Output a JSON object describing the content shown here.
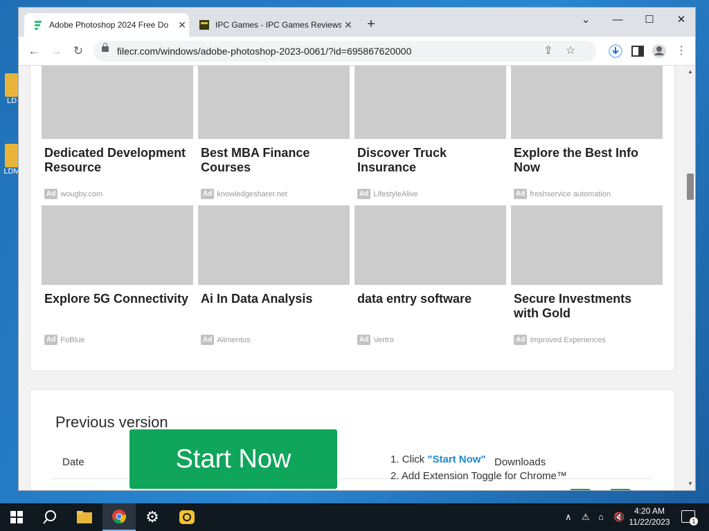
{
  "desktop": {
    "icons": [
      {
        "label": "LD"
      },
      {
        "label": "LDM"
      }
    ]
  },
  "browser": {
    "tabs": [
      {
        "title": "Adobe Photoshop 2024 Free Do",
        "active": true
      },
      {
        "title": "IPC Games - IPC Games Reviews",
        "active": false
      }
    ],
    "new_tab": "+",
    "url": "filecr.com/windows/adobe-photoshop-2023-0061/?id=695867620000"
  },
  "ads": [
    {
      "title": "Dedicated Development Resource",
      "source": "wougby.com"
    },
    {
      "title": "Best MBA Finance Courses",
      "source": "knowledgesharer.net"
    },
    {
      "title": "Discover Truck Insurance",
      "source": "LifestyleAlive"
    },
    {
      "title": "Explore the Best Info Now",
      "source": "freshservice automation"
    },
    {
      "title": "Explore 5G Connectivity",
      "source": "FoBlue"
    },
    {
      "title": "Ai In Data Analysis",
      "source": "Alimentus"
    },
    {
      "title": "data entry software",
      "source": "Vertro"
    },
    {
      "title": "Secure Investments with Gold",
      "source": "Improved Experiences"
    }
  ],
  "ad_label": "Ad",
  "previous_version": {
    "title": "Previous version",
    "col_date": "Date",
    "col_downloads": "Downloads"
  },
  "overlay_ad": {
    "button": "Start Now",
    "step1_prefix": "1. Click ",
    "step1_link": "\"Start Now\"",
    "step2": "2. Add Extension Toggle for Chrome™"
  },
  "taskbar": {
    "time": "4:20 AM",
    "date": "11/22/2023",
    "notifications": "1"
  },
  "colors": {
    "start_button": "#0fa55a",
    "link": "#1a8ad6",
    "ad_image": "#cccccc"
  }
}
